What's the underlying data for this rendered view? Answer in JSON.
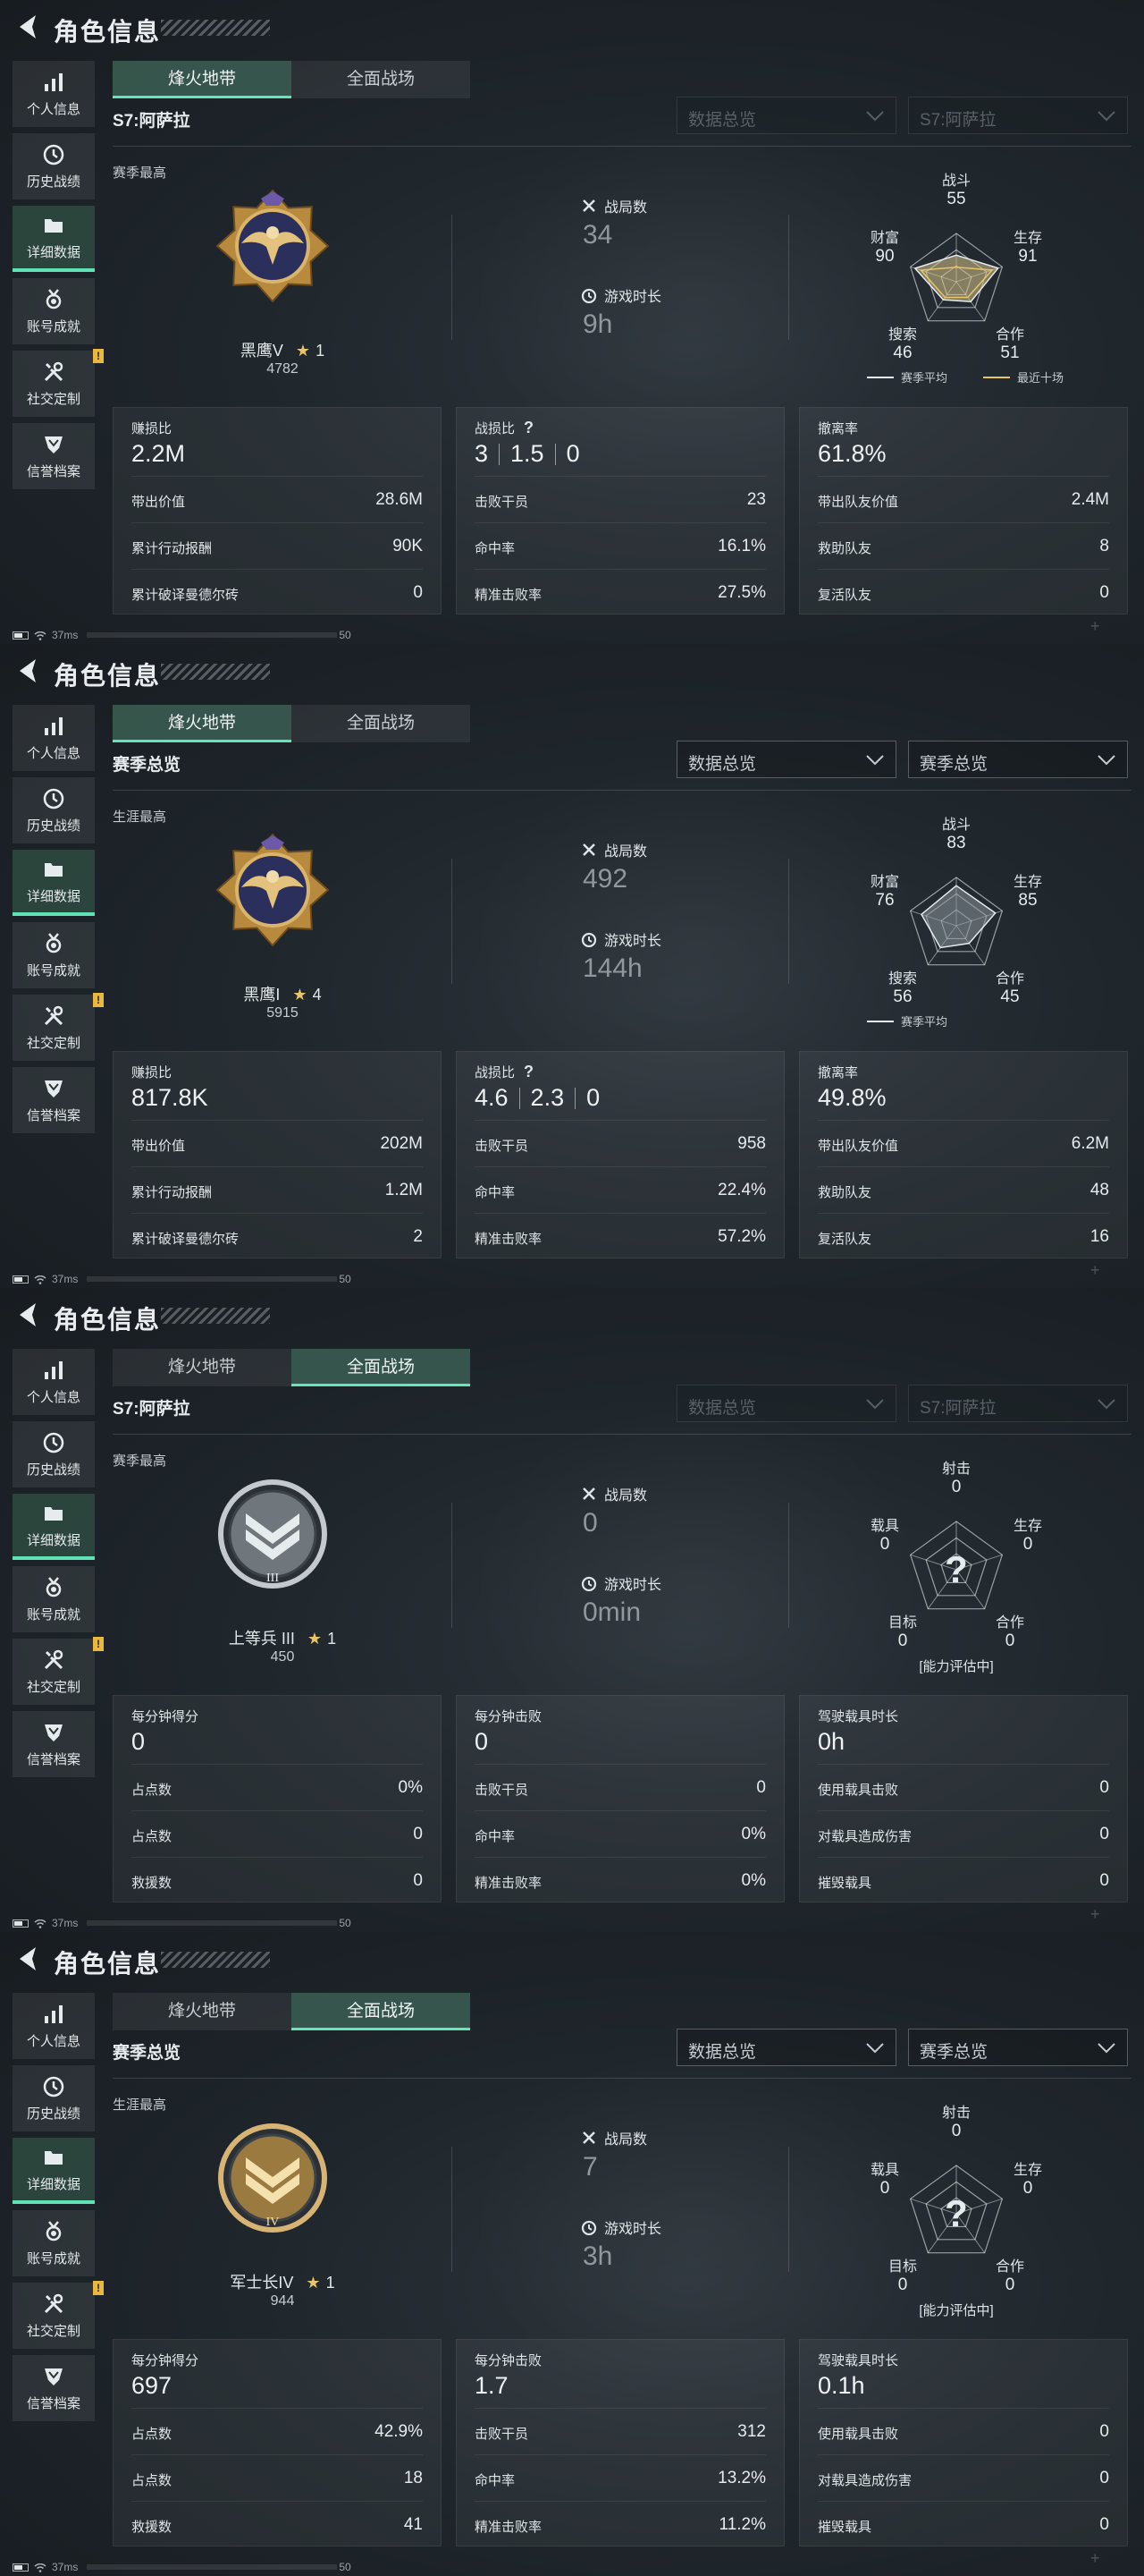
{
  "screens": [
    {
      "title": "角色信息",
      "nav": [
        {
          "label": "个人信息",
          "icon": "bar-chart-icon"
        },
        {
          "label": "历史战绩",
          "icon": "clock-icon"
        },
        {
          "label": "详细数据",
          "icon": "folder-icon"
        },
        {
          "label": "账号成就",
          "icon": "medal-icon"
        },
        {
          "label": "社交定制",
          "icon": "tools-icon"
        },
        {
          "label": "信誉档案",
          "icon": "shield-icon"
        }
      ],
      "active_nav": 2,
      "nav_warning": "!",
      "tabs": [
        "烽火地带",
        "全面战场"
      ],
      "active_tab": 0,
      "season_title": "S7:阿萨拉",
      "dropdown1": "数据总览",
      "dropdown2": "S7:阿萨拉",
      "dropdowns_dim": true,
      "best_label": "赛季最高",
      "rank": {
        "name": "黑鹰V",
        "star_symbol": "★",
        "stars": "1",
        "points": "4782",
        "style": "eagle"
      },
      "battles": {
        "label": "战局数",
        "value": "34"
      },
      "playtime": {
        "label": "游戏时长",
        "value": "9h"
      },
      "radar": {
        "mode": "values",
        "labels": [
          "战斗",
          "生存",
          "合作",
          "搜索",
          "财富"
        ],
        "values": [
          "55",
          "91",
          "51",
          "46",
          "90"
        ],
        "levels": [
          0.55,
          0.91,
          0.51,
          0.46,
          0.9
        ],
        "recent_levels": [
          0.3,
          0.78,
          0.4,
          0.4,
          0.77
        ],
        "fill_color": "#d7c289",
        "legend": [
          "赛季平均",
          "最近十场"
        ],
        "legend_colors": [
          "#e6ebee",
          "#e8c56a"
        ]
      },
      "cards": [
        {
          "head_label": "赚损比",
          "head_values": [
            "2.2M"
          ],
          "rows": [
            [
              "带出价值",
              "28.6M"
            ],
            [
              "累计行动报酬",
              "90K"
            ],
            [
              "累计破译曼德尔砖",
              "0"
            ]
          ]
        },
        {
          "head_label": "战损比",
          "question": "?",
          "head_values": [
            "3",
            "1.5",
            "0"
          ],
          "rows": [
            [
              "击败干员",
              "23"
            ],
            [
              "命中率",
              "16.1%"
            ],
            [
              "精准击败率",
              "27.5%"
            ]
          ]
        },
        {
          "head_label": "撤离率",
          "head_values": [
            "61.8%"
          ],
          "rows": [
            [
              "带出队友价值",
              "2.4M"
            ],
            [
              "救助队友",
              "8"
            ],
            [
              "复活队友",
              "0"
            ]
          ]
        }
      ],
      "status": {
        "ping": "37ms",
        "fps": "50"
      }
    },
    {
      "title": "角色信息",
      "nav": [
        {
          "label": "个人信息",
          "icon": "bar-chart-icon"
        },
        {
          "label": "历史战绩",
          "icon": "clock-icon"
        },
        {
          "label": "详细数据",
          "icon": "folder-icon"
        },
        {
          "label": "账号成就",
          "icon": "medal-icon"
        },
        {
          "label": "社交定制",
          "icon": "tools-icon"
        },
        {
          "label": "信誉档案",
          "icon": "shield-icon"
        }
      ],
      "active_nav": 2,
      "nav_warning": "!",
      "tabs": [
        "烽火地带",
        "全面战场"
      ],
      "active_tab": 0,
      "season_title": "赛季总览",
      "dropdown1": "数据总览",
      "dropdown2": "赛季总览",
      "dropdowns_dim": false,
      "best_label": "生涯最高",
      "rank": {
        "name": "黑鹰I",
        "star_symbol": "★",
        "stars": "4",
        "points": "5915",
        "style": "eagle"
      },
      "battles": {
        "label": "战局数",
        "value": "492"
      },
      "playtime": {
        "label": "游戏时长",
        "value": "144h"
      },
      "radar": {
        "mode": "values",
        "labels": [
          "战斗",
          "生存",
          "合作",
          "搜索",
          "财富"
        ],
        "values": [
          "83",
          "85",
          "45",
          "56",
          "76"
        ],
        "levels": [
          0.83,
          0.85,
          0.45,
          0.56,
          0.76
        ],
        "recent_levels": null,
        "fill_color": "#8c969c",
        "legend": [
          "赛季平均"
        ],
        "legend_colors": [
          "#e6ebee"
        ]
      },
      "cards": [
        {
          "head_label": "赚损比",
          "head_values": [
            "817.8K"
          ],
          "rows": [
            [
              "带出价值",
              "202M"
            ],
            [
              "累计行动报酬",
              "1.2M"
            ],
            [
              "累计破译曼德尔砖",
              "2"
            ]
          ]
        },
        {
          "head_label": "战损比",
          "question": "?",
          "head_values": [
            "4.6",
            "2.3",
            "0"
          ],
          "rows": [
            [
              "击败干员",
              "958"
            ],
            [
              "命中率",
              "22.4%"
            ],
            [
              "精准击败率",
              "57.2%"
            ]
          ]
        },
        {
          "head_label": "撤离率",
          "head_values": [
            "49.8%"
          ],
          "rows": [
            [
              "带出队友价值",
              "6.2M"
            ],
            [
              "救助队友",
              "48"
            ],
            [
              "复活队友",
              "16"
            ]
          ]
        }
      ],
      "status": {
        "ping": "37ms",
        "fps": "50"
      }
    },
    {
      "title": "角色信息",
      "nav": [
        {
          "label": "个人信息",
          "icon": "bar-chart-icon"
        },
        {
          "label": "历史战绩",
          "icon": "clock-icon"
        },
        {
          "label": "详细数据",
          "icon": "folder-icon"
        },
        {
          "label": "账号成就",
          "icon": "medal-icon"
        },
        {
          "label": "社交定制",
          "icon": "tools-icon"
        },
        {
          "label": "信誉档案",
          "icon": "shield-icon"
        }
      ],
      "active_nav": 2,
      "nav_warning": "!",
      "tabs": [
        "烽火地带",
        "全面战场"
      ],
      "active_tab": 1,
      "season_title": "S7:阿萨拉",
      "dropdown1": "数据总览",
      "dropdown2": "S7:阿萨拉",
      "dropdowns_dim": true,
      "best_label": "赛季最高",
      "rank": {
        "name": "上等兵 III",
        "star_symbol": "★",
        "stars": "1",
        "points": "450",
        "style": "silver",
        "badge_text": "III"
      },
      "battles": {
        "label": "战局数",
        "value": "0"
      },
      "playtime": {
        "label": "游戏时长",
        "value": "0min"
      },
      "radar": {
        "mode": "unknown",
        "labels": [
          "射击",
          "生存",
          "合作",
          "目标",
          "载具"
        ],
        "values": [
          "0",
          "0",
          "0",
          "0",
          "0"
        ],
        "unknown_mark": "?",
        "eval_text": "[能力评估中]"
      },
      "cards": [
        {
          "head_label": "每分钟得分",
          "head_values": [
            "0"
          ],
          "rows": [
            [
              "占点数",
              "0%"
            ],
            [
              "占点数",
              "0"
            ],
            [
              "救援数",
              "0"
            ]
          ]
        },
        {
          "head_label": "每分钟击败",
          "head_values": [
            "0"
          ],
          "rows": [
            [
              "击败干员",
              "0"
            ],
            [
              "命中率",
              "0%"
            ],
            [
              "精准击败率",
              "0%"
            ]
          ]
        },
        {
          "head_label": "驾驶载具时长",
          "head_values": [
            "0h"
          ],
          "rows": [
            [
              "使用载具击败",
              "0"
            ],
            [
              "对载具造成伤害",
              "0"
            ],
            [
              "摧毁载具",
              "0"
            ]
          ]
        }
      ],
      "status": {
        "ping": "37ms",
        "fps": "50"
      }
    },
    {
      "title": "角色信息",
      "nav": [
        {
          "label": "个人信息",
          "icon": "bar-chart-icon"
        },
        {
          "label": "历史战绩",
          "icon": "clock-icon"
        },
        {
          "label": "详细数据",
          "icon": "folder-icon"
        },
        {
          "label": "账号成就",
          "icon": "medal-icon"
        },
        {
          "label": "社交定制",
          "icon": "tools-icon"
        },
        {
          "label": "信誉档案",
          "icon": "shield-icon"
        }
      ],
      "active_nav": 2,
      "nav_warning": "!",
      "tabs": [
        "烽火地带",
        "全面战场"
      ],
      "active_tab": 1,
      "season_title": "赛季总览",
      "dropdown1": "数据总览",
      "dropdown2": "赛季总览",
      "dropdowns_dim": false,
      "best_label": "生涯最高",
      "rank": {
        "name": "军士长IV",
        "star_symbol": "★",
        "stars": "1",
        "points": "944",
        "style": "gold",
        "badge_text": "IV"
      },
      "battles": {
        "label": "战局数",
        "value": "7"
      },
      "playtime": {
        "label": "游戏时长",
        "value": "3h"
      },
      "radar": {
        "mode": "unknown",
        "labels": [
          "射击",
          "生存",
          "合作",
          "目标",
          "载具"
        ],
        "values": [
          "0",
          "0",
          "0",
          "0",
          "0"
        ],
        "unknown_mark": "?",
        "eval_text": "[能力评估中]"
      },
      "cards": [
        {
          "head_label": "每分钟得分",
          "head_values": [
            "697"
          ],
          "rows": [
            [
              "占点数",
              "42.9%"
            ],
            [
              "占点数",
              "18"
            ],
            [
              "救援数",
              "41"
            ]
          ]
        },
        {
          "head_label": "每分钟击败",
          "head_values": [
            "1.7"
          ],
          "rows": [
            [
              "击败干员",
              "312"
            ],
            [
              "命中率",
              "13.2%"
            ],
            [
              "精准击败率",
              "11.2%"
            ]
          ]
        },
        {
          "head_label": "驾驶载具时长",
          "head_values": [
            "0.1h"
          ],
          "rows": [
            [
              "使用载具击败",
              "0"
            ],
            [
              "对载具造成伤害",
              "0"
            ],
            [
              "摧毁载具",
              "0"
            ]
          ]
        }
      ],
      "status": {
        "ping": "37ms",
        "fps": "50"
      }
    }
  ]
}
